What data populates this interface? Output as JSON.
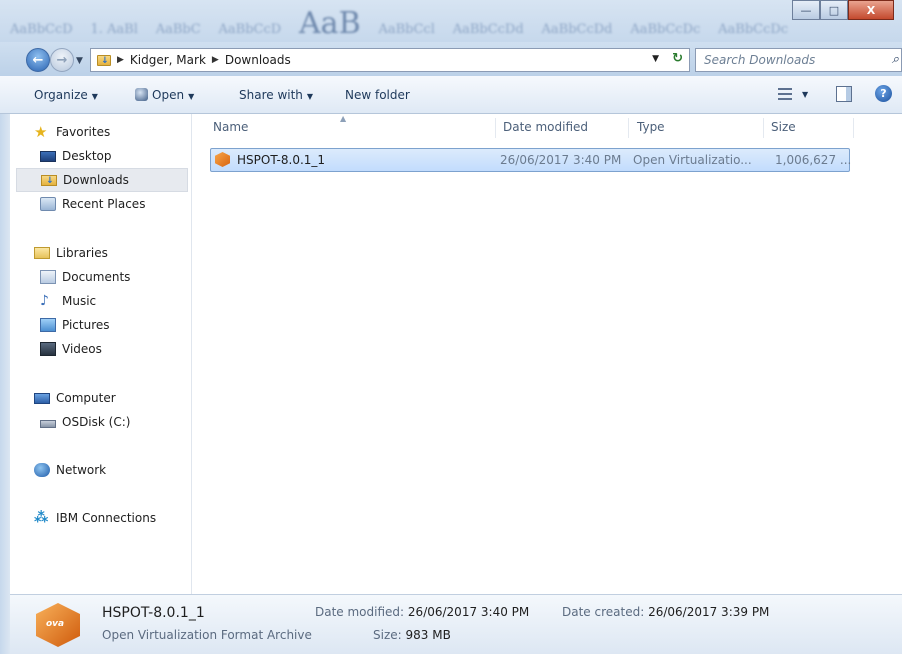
{
  "window": {
    "minimize_glyph": "—",
    "maximize_glyph": "□",
    "close_glyph": "X",
    "background_preview_text": [
      "AaBbCcD",
      "1. AaBl",
      "AaBbC",
      "AaBbCcD",
      "AaB",
      "AaBbCcl",
      "AaBbCcDd",
      "AaBbCcDd",
      "AaBbCcDc",
      "AaBbCcDc"
    ]
  },
  "navigation": {
    "back_glyph": "←",
    "forward_glyph": "→",
    "breadcrumb": [
      "Kidger, Mark",
      "Downloads"
    ],
    "search_placeholder": "Search Downloads"
  },
  "toolbar": {
    "organize_label": "Organize",
    "open_label": "Open",
    "share_label": "Share with",
    "new_folder_label": "New folder",
    "help_glyph": "?"
  },
  "sidebar": {
    "favorites": "Favorites",
    "desktop": "Desktop",
    "downloads": "Downloads",
    "recent_places": "Recent Places",
    "libraries": "Libraries",
    "documents": "Documents",
    "music": "Music",
    "pictures": "Pictures",
    "videos": "Videos",
    "computer": "Computer",
    "osdisk": "OSDisk (C:)",
    "network": "Network",
    "ibm_connections": "IBM Connections"
  },
  "columns": {
    "name": "Name",
    "date_modified": "Date modified",
    "type": "Type",
    "size": "Size"
  },
  "files": [
    {
      "name": "HSPOT-8.0.1_1",
      "date_modified": "26/06/2017 3:40 PM",
      "type": "Open Virtualizatio...",
      "size": "1,006,627 ...",
      "selected": true
    }
  ],
  "details": {
    "name": "HSPOT-8.0.1_1",
    "type": "Open Virtualization Format Archive",
    "date_modified_label": "Date modified:",
    "date_modified": "26/06/2017 3:40 PM",
    "date_created_label": "Date created:",
    "date_created": "26/06/2017 3:39 PM",
    "size_label": "Size:",
    "size": "983 MB",
    "icon_text": "ova"
  },
  "colors": {
    "selection_fill": "#cce0fb",
    "selection_border": "#7da2ce",
    "toolbar_text": "#1e395b"
  }
}
